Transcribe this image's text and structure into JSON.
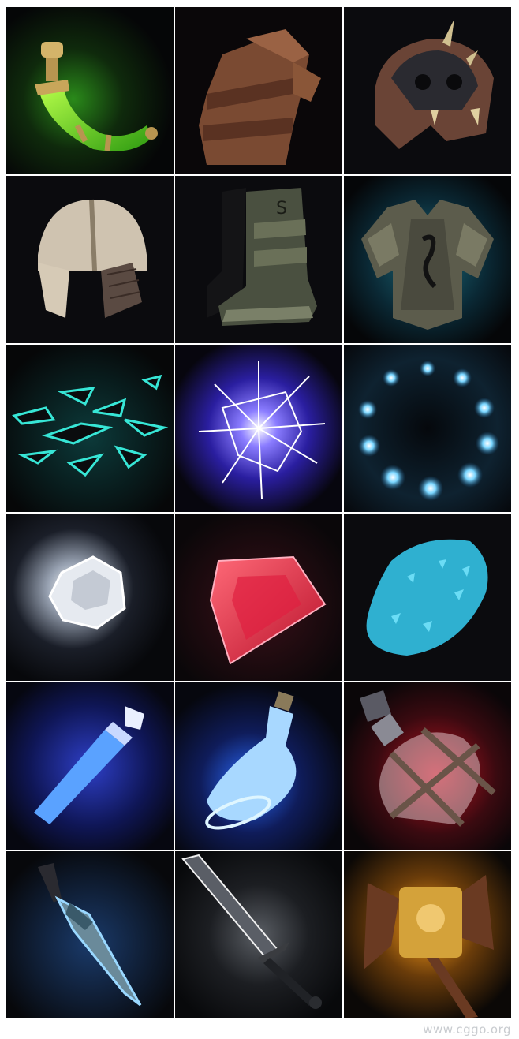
{
  "icons": [
    {
      "name": "horn-potion-icon"
    },
    {
      "name": "leather-gauntlet-icon"
    },
    {
      "name": "skull-pauldron-icon"
    },
    {
      "name": "chain-helmet-icon"
    },
    {
      "name": "iron-boot-icon"
    },
    {
      "name": "chest-armor-icon"
    },
    {
      "name": "shattered-shards-icon"
    },
    {
      "name": "lightning-burst-icon"
    },
    {
      "name": "orb-ring-icon"
    },
    {
      "name": "white-diamond-icon"
    },
    {
      "name": "red-gem-icon"
    },
    {
      "name": "blue-crystal-icon"
    },
    {
      "name": "blue-crystal-vial-icon"
    },
    {
      "name": "blue-flask-icon"
    },
    {
      "name": "red-potion-bottle-icon"
    },
    {
      "name": "blue-dagger-icon"
    },
    {
      "name": "long-sword-icon"
    },
    {
      "name": "golden-axe-icon"
    }
  ],
  "watermark": "www.cggo.org"
}
